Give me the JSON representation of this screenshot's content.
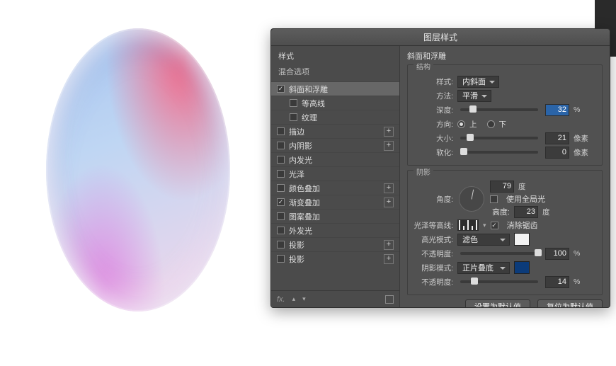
{
  "dialog": {
    "title": "图层样式"
  },
  "left": {
    "styles_header": "样式",
    "blend_options": "混合选项",
    "fx_label": "fx.",
    "effects": [
      {
        "label": "斜面和浮雕",
        "checked": true,
        "selected": true,
        "plus": false,
        "child": false
      },
      {
        "label": "等高线",
        "checked": false,
        "selected": false,
        "plus": false,
        "child": true
      },
      {
        "label": "纹理",
        "checked": false,
        "selected": false,
        "plus": false,
        "child": true
      },
      {
        "label": "描边",
        "checked": false,
        "selected": false,
        "plus": true,
        "child": false
      },
      {
        "label": "内阴影",
        "checked": false,
        "selected": false,
        "plus": true,
        "child": false
      },
      {
        "label": "内发光",
        "checked": false,
        "selected": false,
        "plus": false,
        "child": false
      },
      {
        "label": "光泽",
        "checked": false,
        "selected": false,
        "plus": false,
        "child": false
      },
      {
        "label": "颜色叠加",
        "checked": false,
        "selected": false,
        "plus": true,
        "child": false
      },
      {
        "label": "渐变叠加",
        "checked": true,
        "selected": false,
        "plus": true,
        "child": false
      },
      {
        "label": "图案叠加",
        "checked": false,
        "selected": false,
        "plus": false,
        "child": false
      },
      {
        "label": "外发光",
        "checked": false,
        "selected": false,
        "plus": false,
        "child": false
      },
      {
        "label": "投影",
        "checked": false,
        "selected": false,
        "plus": true,
        "child": false
      },
      {
        "label": "投影",
        "checked": false,
        "selected": false,
        "plus": true,
        "child": false
      }
    ]
  },
  "right": {
    "section_title": "斜面和浮雕",
    "structure_group": "结构",
    "shadow_group": "阴影",
    "style_label": "样式:",
    "style_value": "内斜面",
    "method_label": "方法:",
    "method_value": "平滑",
    "depth_label": "深度:",
    "depth_value": "32",
    "depth_unit": "%",
    "depth_pct": 12,
    "direction_label": "方向:",
    "direction_up": "上",
    "direction_down": "下",
    "direction_value": "up",
    "size_label": "大小:",
    "size_value": "21",
    "size_unit": "像素",
    "size_pct": 8,
    "soften_label": "软化:",
    "soften_value": "0",
    "soften_unit": "像素",
    "soften_pct": 0,
    "angle_label": "角度:",
    "angle_value": "79",
    "angle_unit": "度",
    "global_light_label": "使用全局光",
    "global_light_checked": false,
    "altitude_label": "高度:",
    "altitude_value": "23",
    "altitude_unit": "度",
    "gloss_label": "光泽等高线:",
    "anti_alias_label": "消除锯齿",
    "anti_alias_checked": true,
    "highlight_mode_label": "高光模式:",
    "highlight_mode_value": "滤色",
    "highlight_opacity_label": "不透明度:",
    "highlight_opacity_value": "100",
    "highlight_opacity_unit": "%",
    "highlight_opacity_pct": 100,
    "shadow_mode_label": "阴影模式:",
    "shadow_mode_value": "正片叠底",
    "shadow_opacity_label": "不透明度:",
    "shadow_opacity_value": "14",
    "shadow_opacity_unit": "%",
    "shadow_opacity_pct": 14,
    "set_default": "设置为默认值",
    "reset_default": "复位为默认值"
  }
}
